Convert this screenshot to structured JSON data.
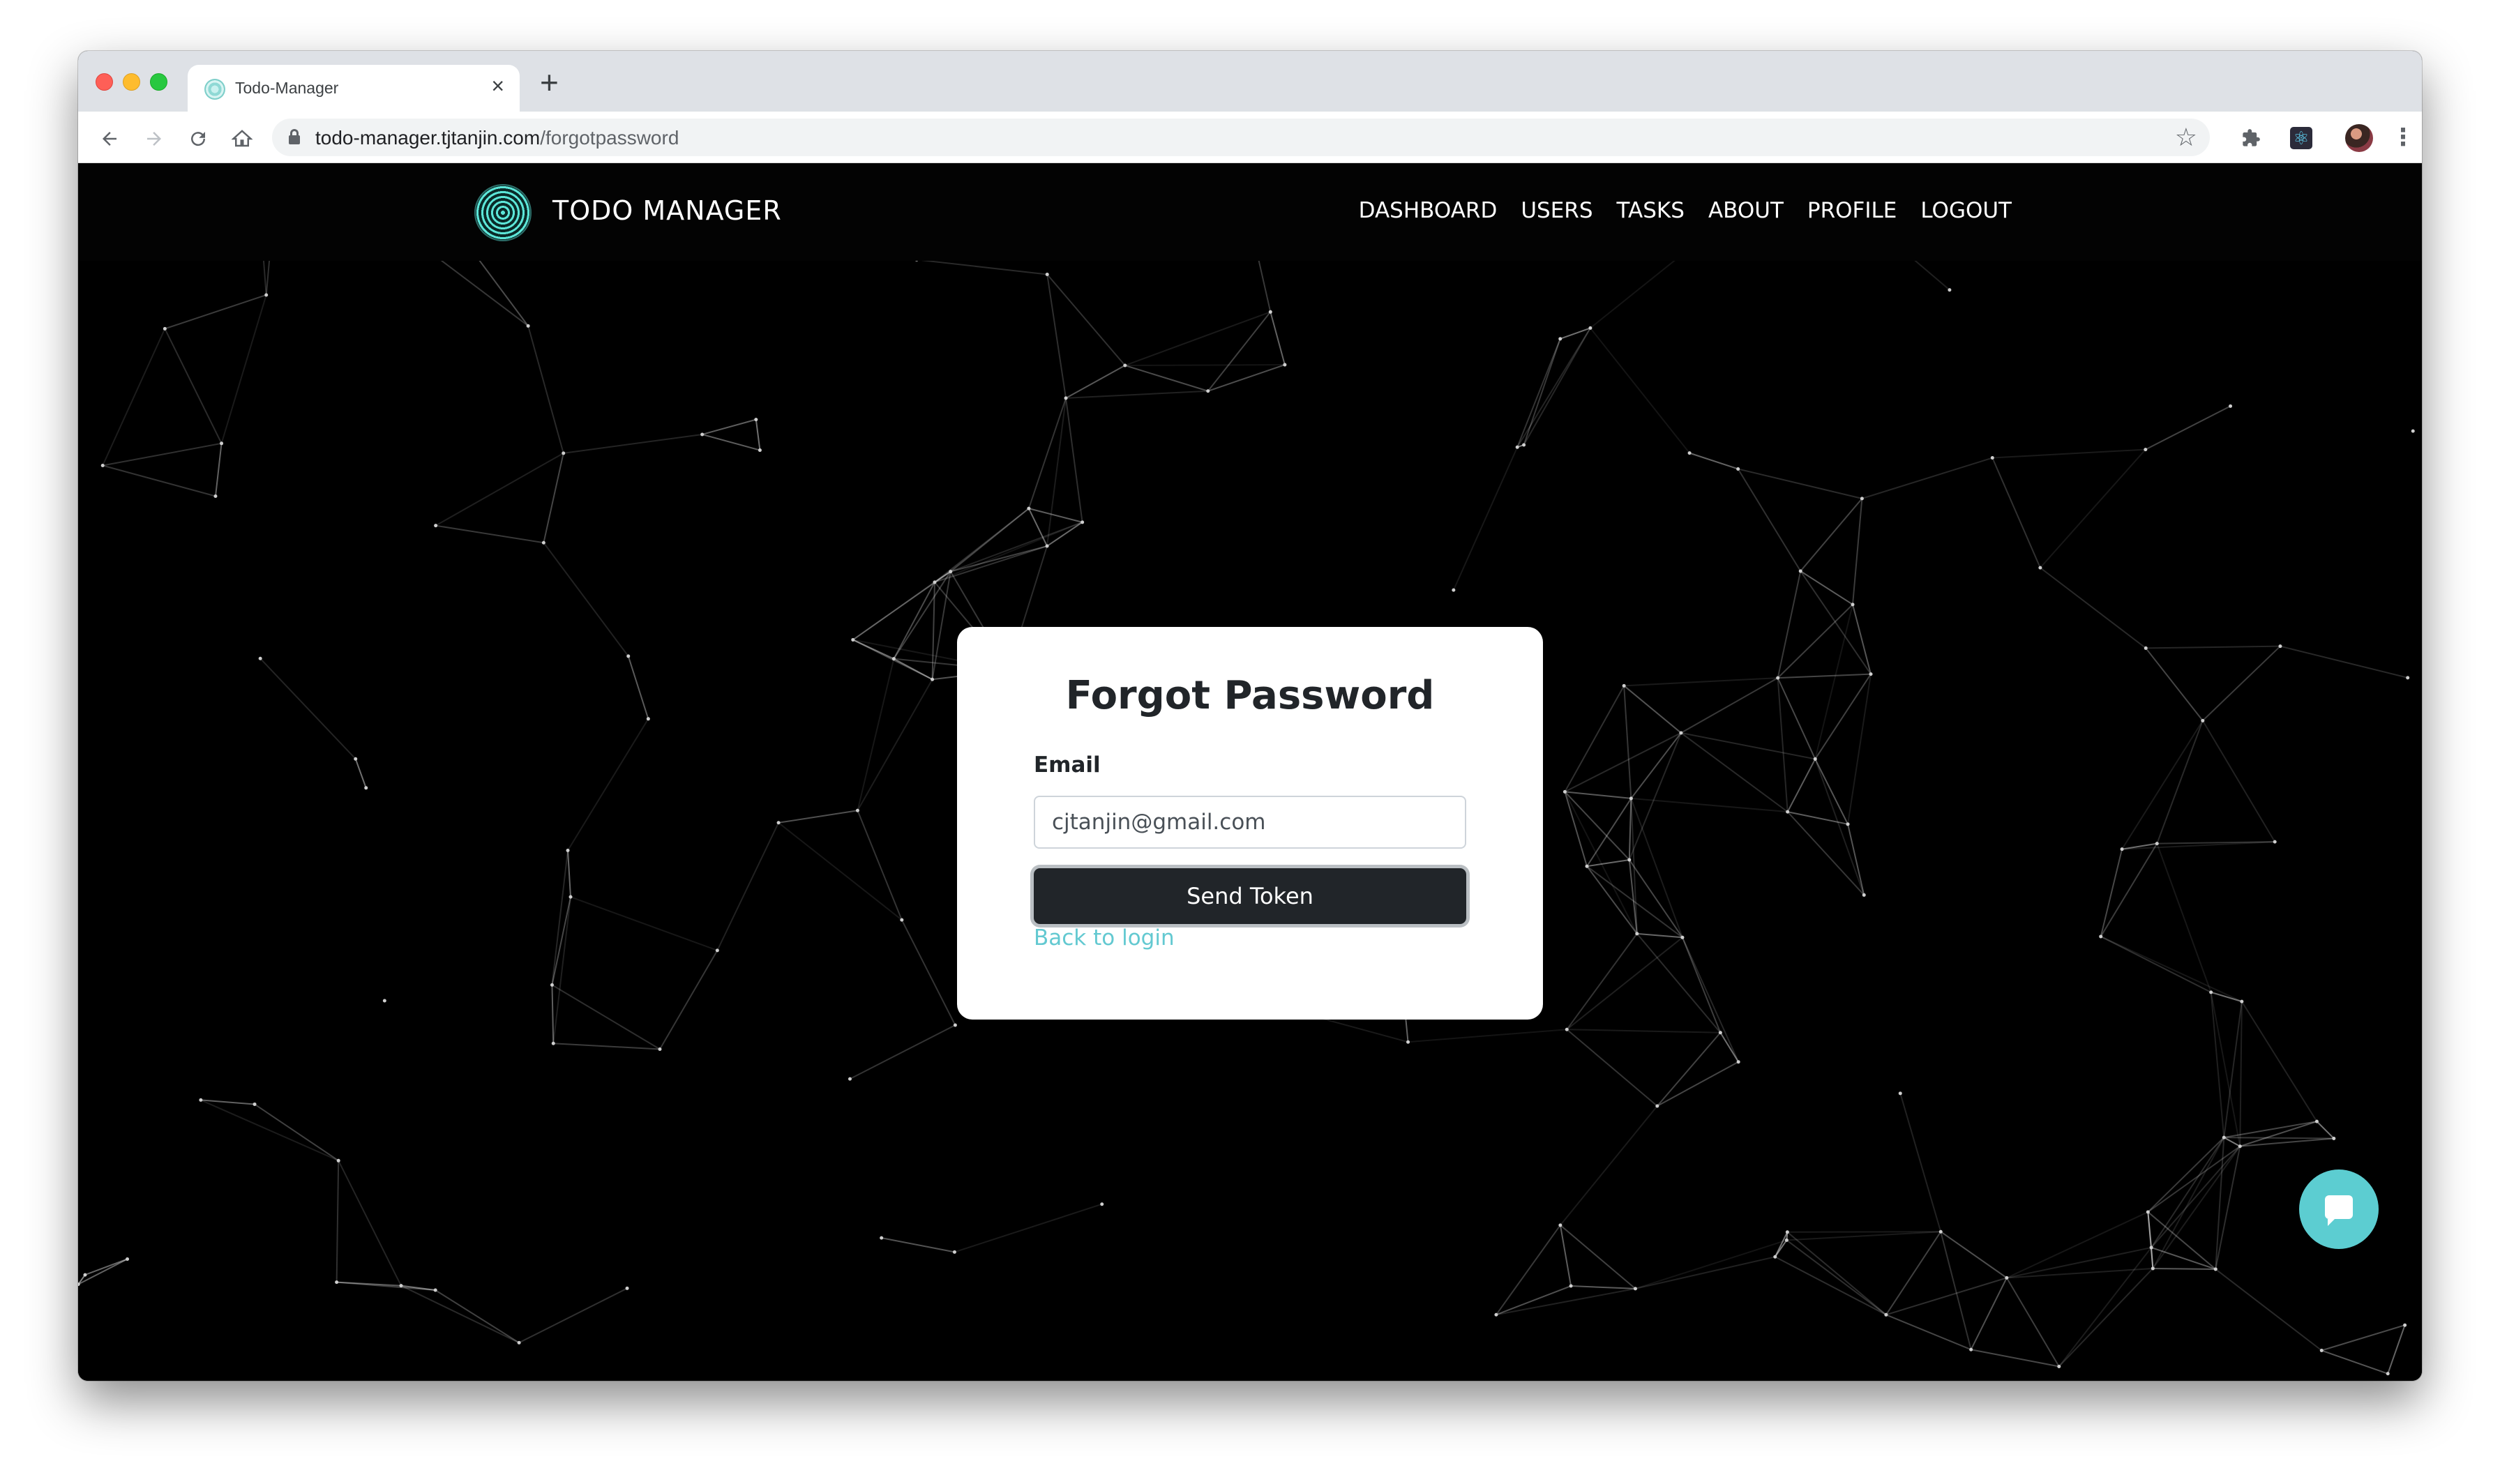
{
  "browser": {
    "tab_title": "Todo-Manager",
    "tab_close": "×",
    "new_tab": "+",
    "url_host": "todo-manager.tjtanjin.com",
    "url_path": "/forgotpassword"
  },
  "navbar": {
    "brand": "TODO MANAGER",
    "links": [
      "DASHBOARD",
      "USERS",
      "TASKS",
      "ABOUT",
      "PROFILE",
      "LOGOUT"
    ]
  },
  "form": {
    "title": "Forgot Password",
    "email_label": "Email",
    "email_value": "cjtanjin@gmail.com",
    "submit_label": "Send Token",
    "back_link": "Back to login"
  },
  "colors": {
    "accent": "#5ccdd1",
    "button": "#212529",
    "page_bg": "#000000"
  },
  "icons": {
    "back": "arrow-left-icon",
    "forward": "arrow-right-icon",
    "reload": "reload-icon",
    "home": "home-icon",
    "bookmark": "star-icon",
    "extensions": "puzzle-icon",
    "menu": "kebab-menu-icon",
    "chat": "chat-icon"
  }
}
